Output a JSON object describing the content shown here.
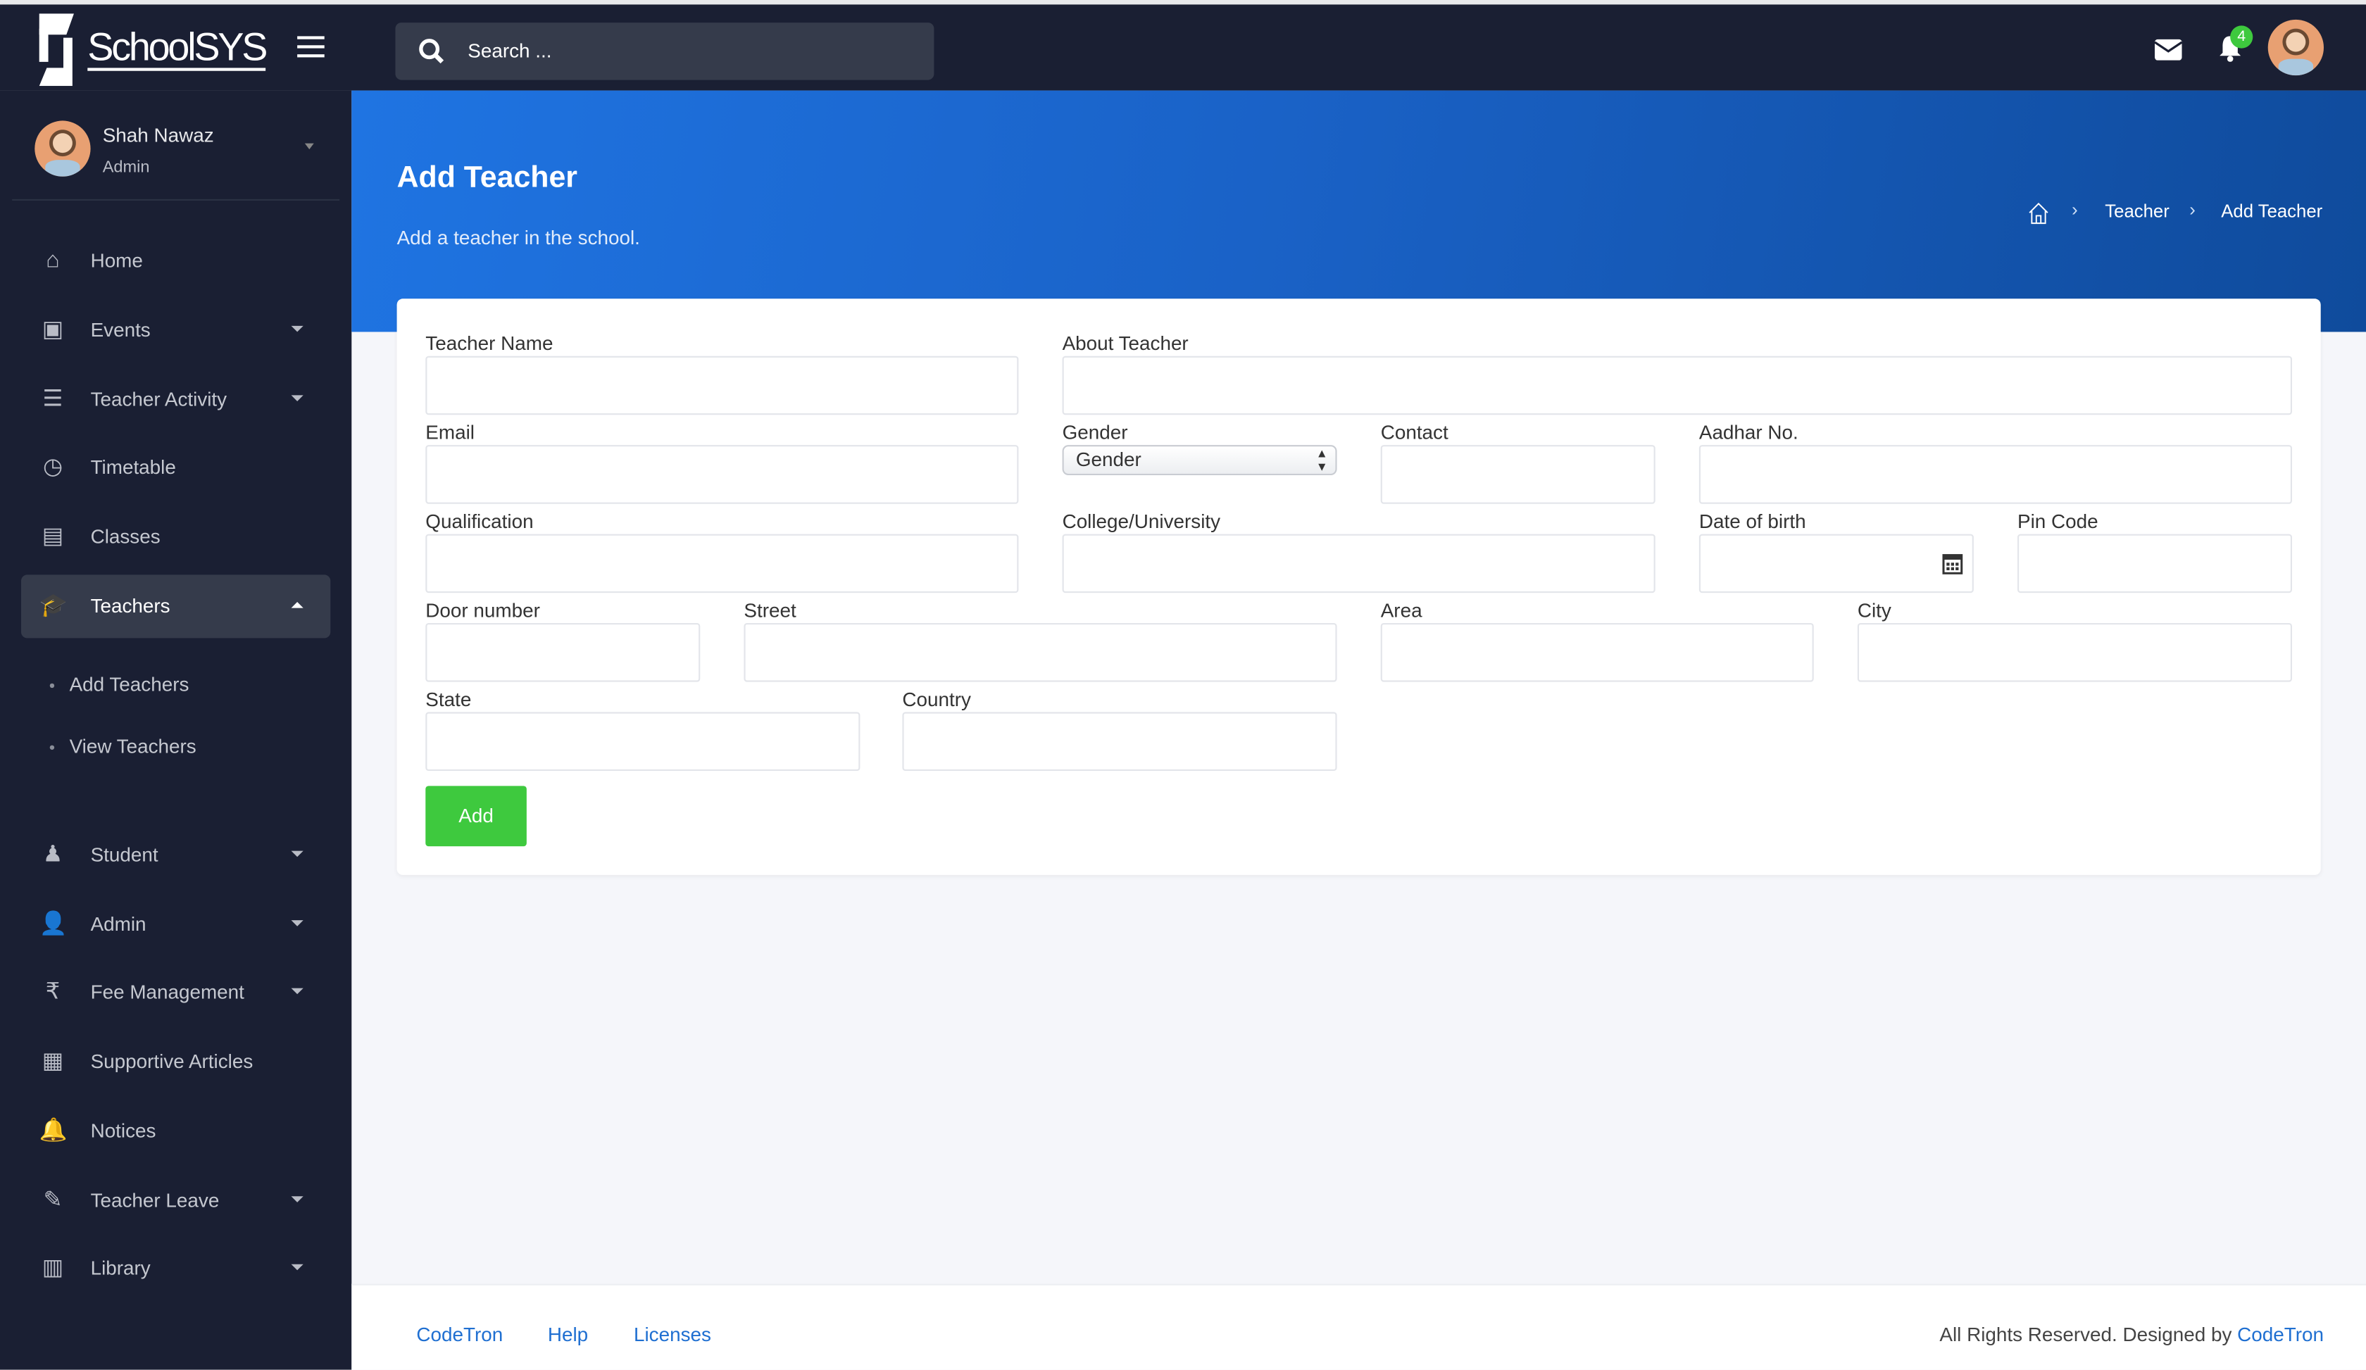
{
  "app": {
    "logo_text": "SchoolSYS",
    "logo_small": "SchoolSys"
  },
  "header": {
    "search_placeholder": "Search ...",
    "notification_count": "4",
    "icons": [
      "menu-icon",
      "search-icon",
      "mail-icon",
      "bell-icon"
    ]
  },
  "user": {
    "name": "Shah Nawaz",
    "role": "Admin"
  },
  "sidebar": {
    "items": [
      {
        "label": "Home",
        "icon": "home-icon",
        "glyph": "⌂",
        "caret": false
      },
      {
        "label": "Events",
        "icon": "calendar-icon",
        "glyph": "▣",
        "caret": true
      },
      {
        "label": "Teacher Activity",
        "icon": "tasks-icon",
        "glyph": "☰",
        "caret": true
      },
      {
        "label": "Timetable",
        "icon": "clock-icon",
        "glyph": "◷",
        "caret": false
      },
      {
        "label": "Classes",
        "icon": "chalkboard-icon",
        "glyph": "▤",
        "caret": false
      },
      {
        "label": "Teachers",
        "icon": "graduation-cap-icon",
        "glyph": "🎓",
        "caret": true,
        "active": true
      },
      {
        "label": "Student",
        "icon": "student-icon",
        "glyph": "♟",
        "caret": true
      },
      {
        "label": "Admin",
        "icon": "user-icon",
        "glyph": "👤",
        "caret": true
      },
      {
        "label": "Fee Management",
        "icon": "rupee-icon",
        "glyph": "₹",
        "caret": true
      },
      {
        "label": "Supportive Articles",
        "icon": "newspaper-icon",
        "glyph": "▦",
        "caret": false
      },
      {
        "label": "Notices",
        "icon": "bell-icon",
        "glyph": "🔔",
        "caret": false
      },
      {
        "label": "Teacher Leave",
        "icon": "pen-icon",
        "glyph": "✎",
        "caret": true
      },
      {
        "label": "Library",
        "icon": "book-icon",
        "glyph": "▥",
        "caret": true
      }
    ],
    "sub_items": [
      "Add Teachers",
      "View Teachers"
    ]
  },
  "page": {
    "title": "Add Teacher",
    "subtitle": "Add a teacher in the school.",
    "breadcrumb": [
      "Teacher",
      "Add Teacher"
    ]
  },
  "form": {
    "fields": [
      {
        "label": "Teacher Name"
      },
      {
        "label": "About Teacher"
      },
      {
        "label": "Email"
      },
      {
        "label": "Gender",
        "type": "select",
        "value": "Gender"
      },
      {
        "label": "Contact"
      },
      {
        "label": "Aadhar No."
      },
      {
        "label": "Qualification"
      },
      {
        "label": "College/University"
      },
      {
        "label": "Date of birth",
        "type": "date"
      },
      {
        "label": "Pin Code"
      },
      {
        "label": "Door number"
      },
      {
        "label": "Street"
      },
      {
        "label": "Area"
      },
      {
        "label": "City"
      },
      {
        "label": "State"
      },
      {
        "label": "Country"
      }
    ],
    "submit_label": "Add"
  },
  "footer": {
    "links": [
      "CodeTron",
      "Help",
      "Licenses"
    ],
    "copyright": "All Rights Reserved. Designed by",
    "designer": "CodeTron"
  },
  "colors": {
    "sidebar": "#1a1f33",
    "accent": "#1f74e2",
    "success": "#3ec93e",
    "badge": "#3ec93e",
    "link": "#1f6fd1"
  }
}
